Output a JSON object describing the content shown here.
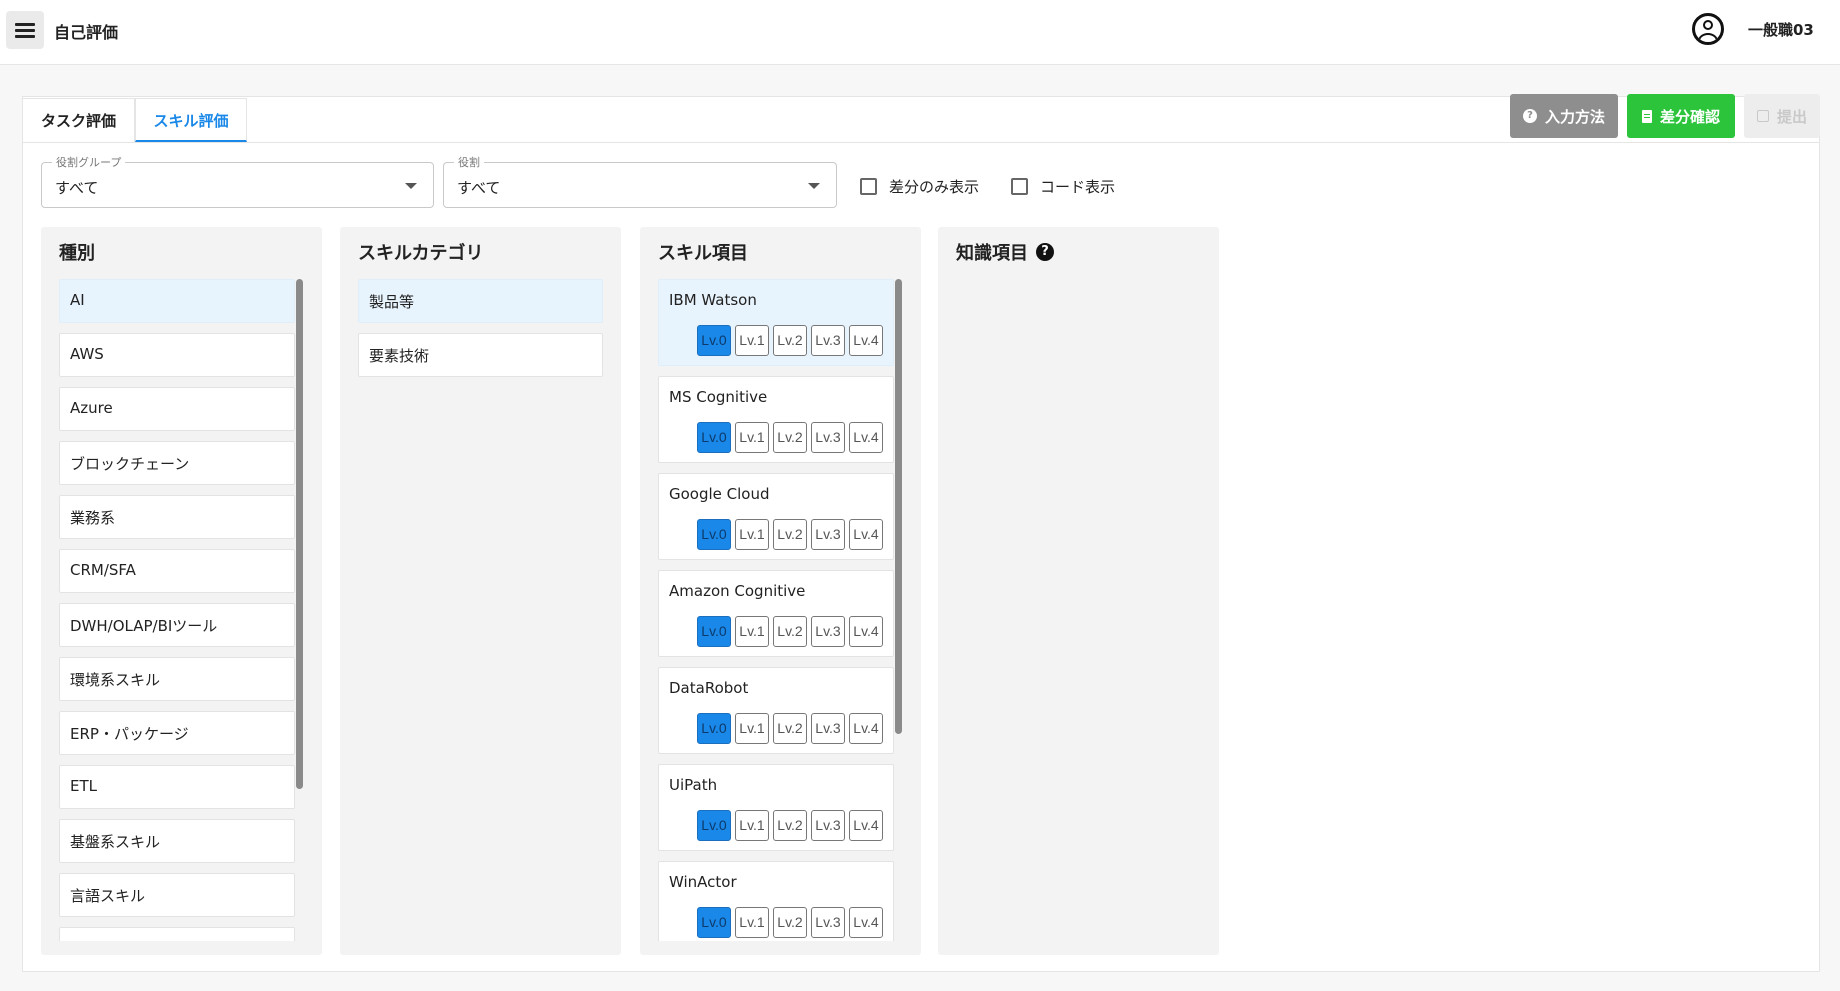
{
  "header": {
    "title": "自己評価",
    "user_name": "一般職03"
  },
  "tabs": [
    {
      "label": "タスク評価"
    },
    {
      "label": "スキル評価"
    }
  ],
  "actions": {
    "help_label": "入力方法",
    "diff_label": "差分確認",
    "submit_label": "提出"
  },
  "filters": {
    "role_group": {
      "label": "役割グループ",
      "value": "すべて"
    },
    "role": {
      "label": "役割",
      "value": "すべて"
    },
    "diff_only_label": "差分のみ表示",
    "show_code_label": "コード表示"
  },
  "columns": {
    "type": {
      "title": "種別",
      "items": [
        "AI",
        "AWS",
        "Azure",
        "ブロックチェーン",
        "業務系",
        "CRM/SFA",
        "DWH/OLAP/BIツール",
        "環境系スキル",
        "ERP・パッケージ",
        "ETL",
        "基盤系スキル",
        "言語スキル",
        ""
      ]
    },
    "category": {
      "title": "スキルカテゴリ",
      "items": [
        "製品等",
        "要素技術"
      ]
    },
    "skill": {
      "title": "スキル項目",
      "levels": [
        "Lv.0",
        "Lv.1",
        "Lv.2",
        "Lv.3",
        "Lv.4"
      ],
      "items": [
        {
          "name": "IBM Watson",
          "level": 0
        },
        {
          "name": "MS Cognitive",
          "level": 0
        },
        {
          "name": "Google Cloud",
          "level": 0
        },
        {
          "name": "Amazon Cognitive",
          "level": 0
        },
        {
          "name": "DataRobot",
          "level": 0
        },
        {
          "name": "UiPath",
          "level": 0
        },
        {
          "name": "WinActor",
          "level": 0
        }
      ]
    },
    "knowledge": {
      "title": "知識項目",
      "help_icon": "?"
    }
  },
  "colors": {
    "accent": "#1a88e8",
    "success": "#2bc43b",
    "muted": "#8e8e8e"
  }
}
